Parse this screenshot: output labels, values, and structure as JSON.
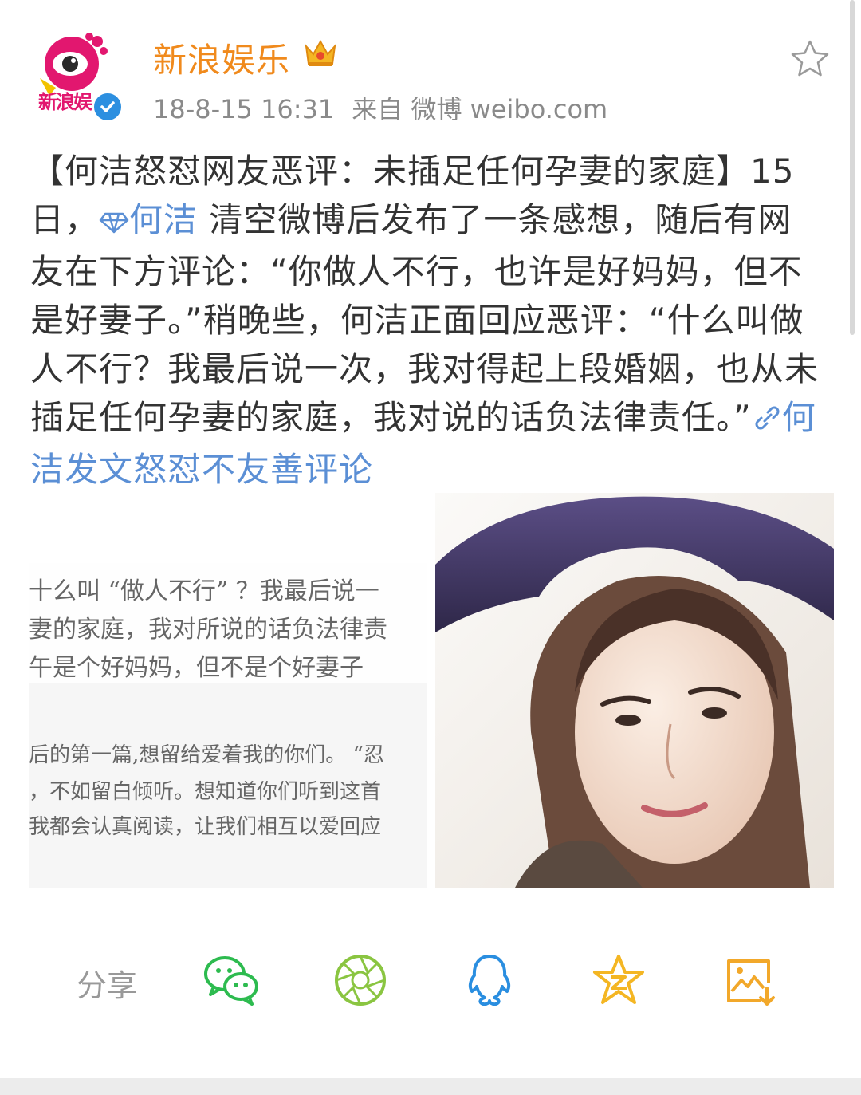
{
  "header": {
    "account_name": "新浪娱乐",
    "avatar_text": "新浪娱",
    "timestamp": "18-8-15 16:31",
    "source": "来自 微博 weibo.com"
  },
  "post": {
    "part1": "【何洁怒怼网友恶评：未插足任何孕妻的家庭】15日，",
    "mention": "何洁",
    "part2": " 清空微博后发布了一条感想，随后有网友在下方评论：“你做人不行，也许是好妈妈，但不是好妻子。”稍晚些，何洁正面回应恶评：“什么叫做人不行？我最后说一次，我对得起上段婚姻，也从未插足任何孕妻的家庭，我对说的话负法律责任。”",
    "link_text": "何洁发文怒怼不友善评论"
  },
  "screenshot": {
    "line1": "十么叫 “做人不行” ？我最后说一",
    "line2": "妻的家庭，我对所说的话负法律责",
    "line3": "午是个好妈妈，但不是个好妻子",
    "line4": "后的第一篇,想留给爱着我的你们。 “忍",
    "line5": "，不如留白倾听。想知道你们听到这首",
    "line6": "我都会认真阅读，让我们相互以爱回应"
  },
  "share": {
    "label": "分享",
    "icons": [
      "wechat-icon",
      "moments-icon",
      "qq-icon",
      "qzone-icon",
      "save-image-icon"
    ]
  },
  "colors": {
    "account_name": "#f08a1d",
    "link": "#5b8fd5",
    "wechat": "#2dbb4f",
    "moments": "#8ac541",
    "qq": "#2a8ee0",
    "qzone": "#f4b623",
    "save_image": "#f2a82a",
    "verified": "#2c8fe0"
  }
}
